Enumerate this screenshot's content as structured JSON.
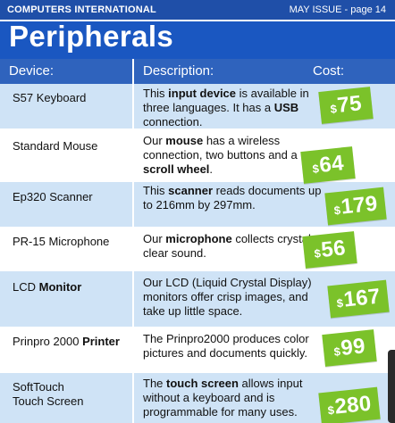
{
  "top_bar": {
    "magazine": "COMPUTERS INTERNATIONAL",
    "issue": "MAY ISSUE - page 14"
  },
  "title": "Peripherals",
  "columns": {
    "device": "Device:",
    "description": "Description:",
    "cost": "Cost:"
  },
  "colors": {
    "accent_blue": "#1a57c1",
    "row_blue": "#cfe3f6",
    "price_green": "#7bc22a"
  },
  "rows": [
    {
      "device": [
        {
          "text": "S57 Keyboard",
          "bold": false
        }
      ],
      "description": [
        {
          "text": "This ",
          "bold": false
        },
        {
          "text": "input device",
          "bold": true
        },
        {
          "text": " is available in three languages. It has a ",
          "bold": false
        },
        {
          "text": "USB",
          "bold": true
        },
        {
          "text": " connection.",
          "bold": false
        }
      ],
      "currency": "$",
      "cost": "75"
    },
    {
      "device": [
        {
          "text": "Standard Mouse",
          "bold": false
        }
      ],
      "description": [
        {
          "text": "Our ",
          "bold": false
        },
        {
          "text": "mouse",
          "bold": true
        },
        {
          "text": " has a wireless connection, two buttons and a ",
          "bold": false
        },
        {
          "text": "scroll wheel",
          "bold": true
        },
        {
          "text": ".",
          "bold": false
        }
      ],
      "currency": "$",
      "cost": "64"
    },
    {
      "device": [
        {
          "text": "Ep320 Scanner",
          "bold": false
        }
      ],
      "description": [
        {
          "text": "This ",
          "bold": false
        },
        {
          "text": "scanner",
          "bold": true
        },
        {
          "text": " reads documents up to 216mm by 297mm.",
          "bold": false
        }
      ],
      "currency": "$",
      "cost": "179"
    },
    {
      "device": [
        {
          "text": "PR-15 Microphone",
          "bold": false
        }
      ],
      "description": [
        {
          "text": "Our ",
          "bold": false
        },
        {
          "text": "microphone",
          "bold": true
        },
        {
          "text": " collects crystal clear sound.",
          "bold": false
        }
      ],
      "currency": "$",
      "cost": "56"
    },
    {
      "device": [
        {
          "text": "LCD ",
          "bold": false
        },
        {
          "text": "Monitor",
          "bold": true
        }
      ],
      "description": [
        {
          "text": "Our LCD (Liquid Crystal Display) monitors offer crisp images, and take up little space.",
          "bold": false
        }
      ],
      "currency": "$",
      "cost": "167"
    },
    {
      "device": [
        {
          "text": "Prinpro 2000 ",
          "bold": false
        },
        {
          "text": "Printer",
          "bold": true
        }
      ],
      "description": [
        {
          "text": "The Prinpro2000 produces color pictures and documents quickly.",
          "bold": false
        }
      ],
      "currency": "$",
      "cost": "99"
    },
    {
      "device": [
        {
          "text": "SoftTouch Touch Screen",
          "bold": false
        }
      ],
      "description": [
        {
          "text": "The ",
          "bold": false
        },
        {
          "text": "touch screen",
          "bold": true
        },
        {
          "text": " allows input without a keyboard and is programmable for many uses.",
          "bold": false
        }
      ],
      "currency": "$",
      "cost": "280"
    }
  ]
}
